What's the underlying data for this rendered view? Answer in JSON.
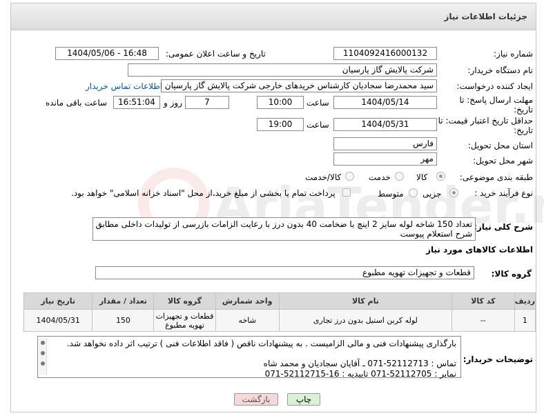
{
  "header": {
    "title": "جزئیات اطلاعات نیاز"
  },
  "labels": {
    "need_number": "شماره نیاز:",
    "announce_datetime": "تاریخ و ساعت اعلان عمومی:",
    "buyer_org": "نام دستگاه خریدار:",
    "requester": "ایجاد کننده درخواست:",
    "reply_deadline": "مهلت ارسال پاسخ: تا تاریخ:",
    "price_validity": "حداقل تاریخ اعتبار قیمت: تا تاریخ:",
    "time": "ساعت",
    "day_and": "روز و",
    "remaining": "ساعت باقی مانده",
    "province": "استان محل تحویل:",
    "city": "شهر محل تحویل:",
    "category": "طبقه بندی موضوعی:",
    "process_type": "نوع فرآیند خرید :",
    "general_desc": "شرح کلی نیاز:",
    "goods_info": "اطلاعات کالاهای مورد نیاز",
    "goods_group": "گروه کالا:",
    "buyer_notes": "توضیحات خریدار:"
  },
  "fields": {
    "need_number": "1104092416000132",
    "announce_datetime": "1404/05/06 - 16:48",
    "buyer_org": "شرکت پالایش گاز پارسیان",
    "requester": "سید محمدرضا سجادیان کارشناس خریدهای خارجی شرکت پالایش گاز پارسیان",
    "contact_link": "اطلاعات تماس خریدار",
    "reply_date": "1404/05/14",
    "reply_time": "10:00",
    "reply_days": "7",
    "reply_remaining": "16:51:04",
    "validity_date": "1404/05/31",
    "validity_time": "19:00",
    "province": "فارس",
    "city": "مهر",
    "general_desc_line1": "تعداد 150 شاخه لوله سایز 2 اینچ با ضخامت 40 بدون درز با رعایت الزامات بازرسی از تولیدات داخلی مطابق",
    "general_desc_line2": "شرح استعلام پیوست",
    "goods_group": "قطعات و تجهیزات تهویه مطبوع"
  },
  "category_options": [
    "کالا",
    "خدمت",
    "کالا/خدمت"
  ],
  "category_selected": "کالا",
  "process_options": [
    "جزیی",
    "متوسط"
  ],
  "process_selected": "جزیی",
  "payment_note": "پرداخت تمام یا بخشی از مبلغ خرید،از محل \"اسناد خزانه اسلامی\" خواهد بود.",
  "table": {
    "headers": [
      "ردیف",
      "کد کالا",
      "نام کالا",
      "واحد شمارش",
      "گروه کالا",
      "تعداد / مقدار",
      "تاریخ نیاز"
    ],
    "rows": [
      [
        "1",
        "--",
        "لوله کربن استیل بدون درز تجاری",
        "شاخه",
        "قطعات و تجهیزات تهویه مطبوع",
        "150",
        "1404/05/31"
      ]
    ]
  },
  "notes": {
    "line1": "بارگذاری پیشنهادات فنی و مالی الزامیست . به پیشنهادات ناقص ( فاقد اطلاعات فنی ) ترتیب اثر داده نخواهد شد.",
    "line2": "تماس : 52112713-071 ـ آقایان سجادیان و محمد شاه",
    "line3": "نمابر : 52112705-071 تاییدیه : 16-52112715-071"
  },
  "buttons": {
    "print": "چاپ",
    "back": "بازگشت"
  },
  "watermark_text": "AriaTender.neT",
  "colors": {
    "link": "#0056b3",
    "header_bg": "#dcdcdc",
    "table_header_bg": "#d9d9d9",
    "back_btn_bg": "#f7d8d8",
    "print_btn_bg": "#dbf1d4",
    "watermark": "#d43c2f"
  }
}
